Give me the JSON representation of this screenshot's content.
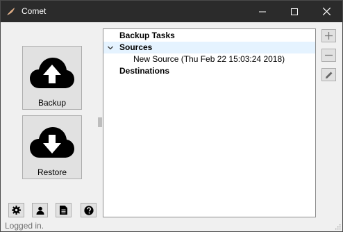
{
  "window": {
    "title": "Comet"
  },
  "actions": {
    "backup_label": "Backup",
    "restore_label": "Restore"
  },
  "tree": {
    "root_label": "Backup Tasks",
    "sources_label": "Sources",
    "source_item": "New Source (Thu Feb 22 15:03:24 2018)",
    "destinations_label": "Destinations"
  },
  "status": {
    "text": "Logged in."
  },
  "icons": {
    "app": "comet-logo-icon",
    "minimize": "minimize-icon",
    "maximize": "maximize-icon",
    "close": "close-icon",
    "backup": "cloud-upload-icon",
    "restore": "cloud-download-icon",
    "add": "plus-icon",
    "remove": "minus-icon",
    "edit": "pencil-icon",
    "settings": "gear-icon",
    "account": "user-icon",
    "log": "document-icon",
    "help": "help-icon"
  }
}
